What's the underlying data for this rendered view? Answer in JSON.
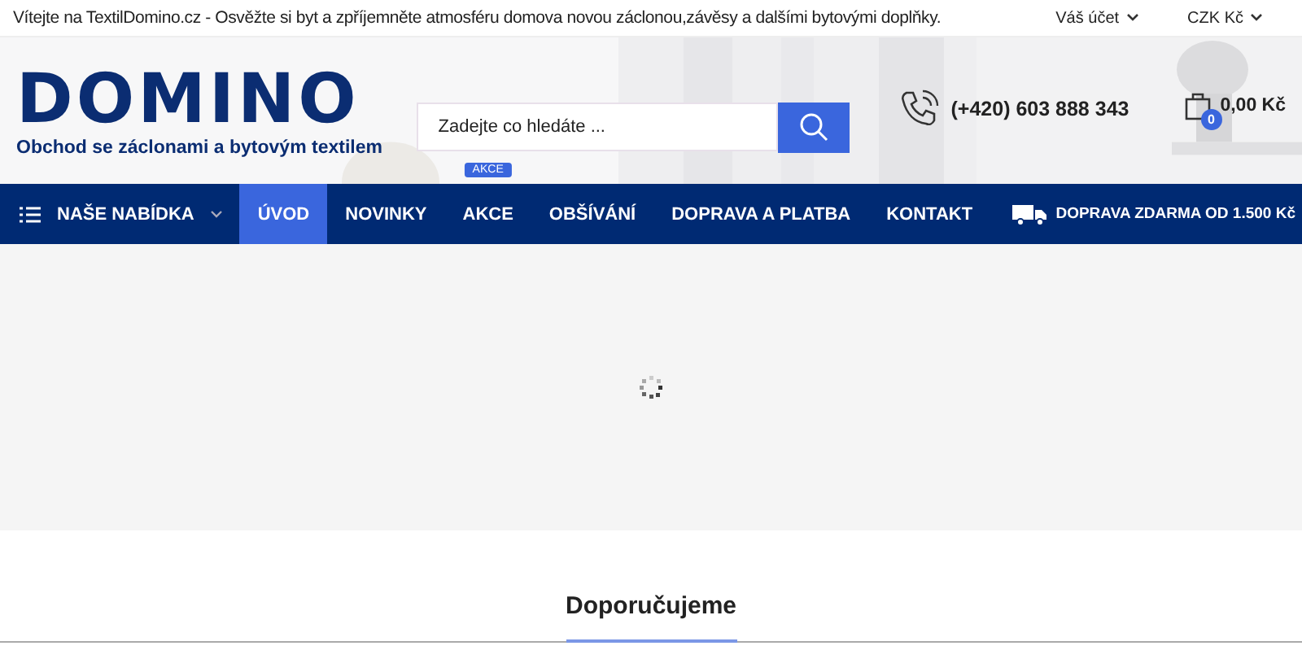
{
  "top_bar": {
    "message": "Vítejte na TextilDomino.cz - Osvěžte si byt a zpříjemněte atmosféru domova novou záclonou,závěsy a dalšími bytovými doplňky.",
    "account": "Váš účet",
    "currency": "CZK Kč"
  },
  "header": {
    "logo": {
      "name": "DOMINO",
      "tagline": "Obchod se záclonami a bytovým textilem"
    },
    "search": {
      "placeholder": "Zadejte co hledáte ..."
    },
    "phone": "(+420) 603 888 343",
    "cart": {
      "count": "0",
      "total": "0,00 Kč"
    }
  },
  "nav": {
    "menu_label": "NAŠE NABÍDKA",
    "items": [
      {
        "label": "ÚVOD",
        "selected": true
      },
      {
        "label": "NOVINKY",
        "selected": false
      },
      {
        "label": "AKCE",
        "selected": false,
        "badge": "AKCE"
      },
      {
        "label": "OBŠÍVÁNÍ",
        "selected": false
      },
      {
        "label": "DOPRAVA A PLATBA",
        "selected": false
      },
      {
        "label": "KONTAKT",
        "selected": false
      }
    ],
    "shipping": "DOPRAVA ZDARMA OD 1.500 Kč"
  },
  "section": {
    "title": "Doporučujeme"
  }
}
